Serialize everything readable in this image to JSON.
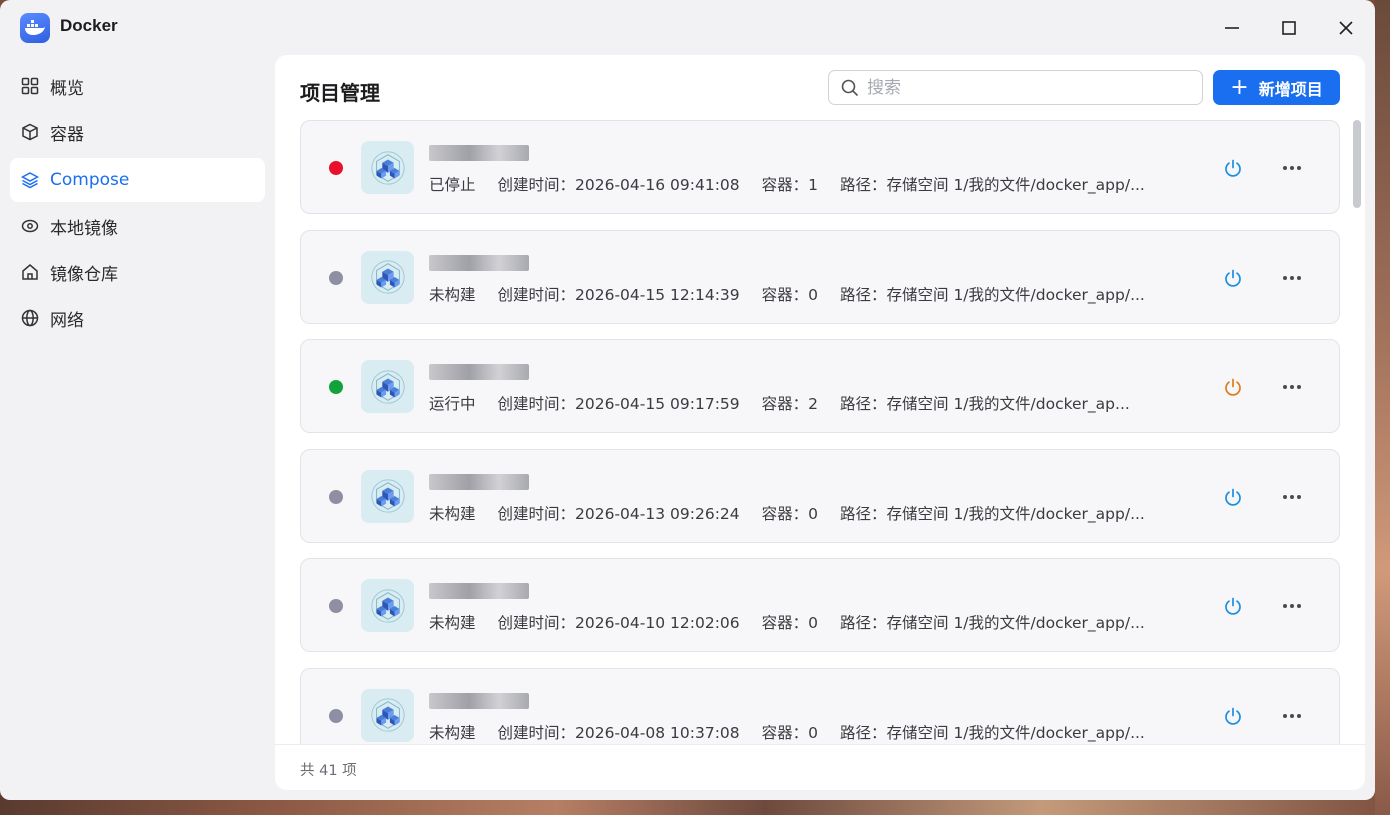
{
  "app": {
    "title": "Docker"
  },
  "window_controls": {
    "minimize": "minimize-icon",
    "maximize": "maximize-icon",
    "close": "close-icon"
  },
  "sidebar": {
    "items": [
      {
        "label": "概览",
        "icon": "grid-icon",
        "active": false
      },
      {
        "label": "容器",
        "icon": "cube-icon",
        "active": false
      },
      {
        "label": "Compose",
        "icon": "layers-icon",
        "active": true
      },
      {
        "label": "本地镜像",
        "icon": "disc-icon",
        "active": false
      },
      {
        "label": "镜像仓库",
        "icon": "home-icon",
        "active": false
      },
      {
        "label": "网络",
        "icon": "globe-icon",
        "active": false
      }
    ]
  },
  "main": {
    "title": "项目管理",
    "search": {
      "placeholder": "搜索",
      "value": ""
    },
    "add_button": {
      "label": "新增项目",
      "icon": "plus-icon"
    },
    "projects": [
      {
        "status": "已停止",
        "status_color": "#e8102b",
        "created": "创建时间：2026-04-16 09:41:08",
        "containers": "容器：1",
        "path": "路径：存储空间 1/我的文件/docker_app/...",
        "power_color": "#1a8fe0"
      },
      {
        "status": "未构建",
        "status_color": "#8e8fa3",
        "created": "创建时间：2026-04-15 12:14:39",
        "containers": "容器：0",
        "path": "路径：存储空间 1/我的文件/docker_app/...",
        "power_color": "#1a8fe0"
      },
      {
        "status": "运行中",
        "status_color": "#12a13a",
        "created": "创建时间：2026-04-15 09:17:59",
        "containers": "容器：2",
        "path": "路径：存储空间 1/我的文件/docker_ap...",
        "power_color": "#e07a1a"
      },
      {
        "status": "未构建",
        "status_color": "#8e8fa3",
        "created": "创建时间：2026-04-13 09:26:24",
        "containers": "容器：0",
        "path": "路径：存储空间 1/我的文件/docker_app/...",
        "power_color": "#1a8fe0"
      },
      {
        "status": "未构建",
        "status_color": "#8e8fa3",
        "created": "创建时间：2026-04-10 12:02:06",
        "containers": "容器：0",
        "path": "路径：存储空间 1/我的文件/docker_app/...",
        "power_color": "#1a8fe0"
      },
      {
        "status": "未构建",
        "status_color": "#8e8fa3",
        "created": "创建时间：2026-04-08 10:37:08",
        "containers": "容器：0",
        "path": "路径：存储空间 1/我的文件/docker_app/...",
        "power_color": "#1a8fe0"
      }
    ],
    "footer": {
      "total": "共 41 项"
    }
  }
}
